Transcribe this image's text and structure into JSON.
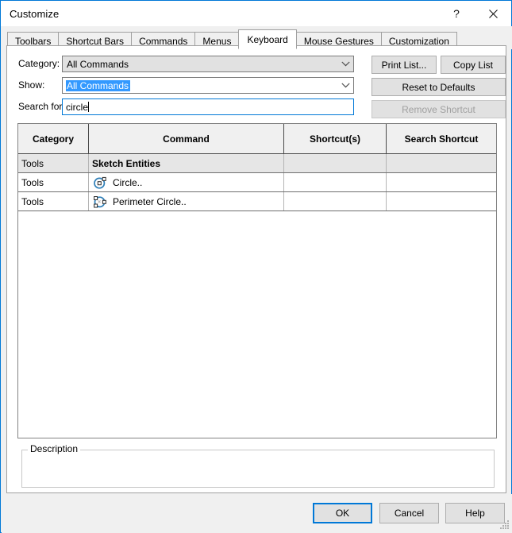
{
  "window": {
    "title": "Customize",
    "help_icon": "question-mark-icon",
    "close_icon": "close-icon",
    "accent_color": "#0078d7",
    "dialog_bg": "#f0f0f0"
  },
  "tabs": [
    {
      "label": "Toolbars",
      "active": false
    },
    {
      "label": "Shortcut Bars",
      "active": false
    },
    {
      "label": "Commands",
      "active": false
    },
    {
      "label": "Menus",
      "active": false
    },
    {
      "label": "Keyboard",
      "active": true
    },
    {
      "label": "Mouse Gestures",
      "active": false
    },
    {
      "label": "Customization",
      "active": false
    }
  ],
  "form": {
    "category": {
      "label": "Category:",
      "value": "All Commands",
      "enabled": false,
      "dropdown_icon": "chevron-down-icon"
    },
    "show": {
      "label": "Show:",
      "value": "All Commands",
      "text_selected": true,
      "selection_color": "#3399ff",
      "dropdown_icon": "chevron-down-icon"
    },
    "search": {
      "label": "Search for:",
      "value": "circle",
      "placeholder": "",
      "focused": true
    }
  },
  "side_buttons": [
    {
      "label": "Print List...",
      "enabled": true
    },
    {
      "label": "Copy List",
      "enabled": true
    },
    {
      "label": "Reset to Defaults",
      "enabled": true
    },
    {
      "label": "Remove Shortcut",
      "enabled": false
    }
  ],
  "command_list": {
    "columns": [
      "Category",
      "Command",
      "Shortcut(s)",
      "Search Shortcut"
    ],
    "rows": [
      {
        "category": "Tools",
        "command": "Sketch Entities",
        "shortcut": "",
        "search_shortcut": "",
        "is_group": true,
        "icon": null
      },
      {
        "category": "Tools",
        "command": "Circle..",
        "shortcut": "",
        "search_shortcut": "",
        "is_group": false,
        "icon": "circle-sketch-icon"
      },
      {
        "category": "Tools",
        "command": "Perimeter Circle..",
        "shortcut": "",
        "search_shortcut": "",
        "is_group": false,
        "icon": "perimeter-circle-sketch-icon"
      }
    ]
  },
  "description": {
    "legend": "Description",
    "text": ""
  },
  "footer_buttons": {
    "ok": "OK",
    "cancel": "Cancel",
    "help": "Help"
  }
}
